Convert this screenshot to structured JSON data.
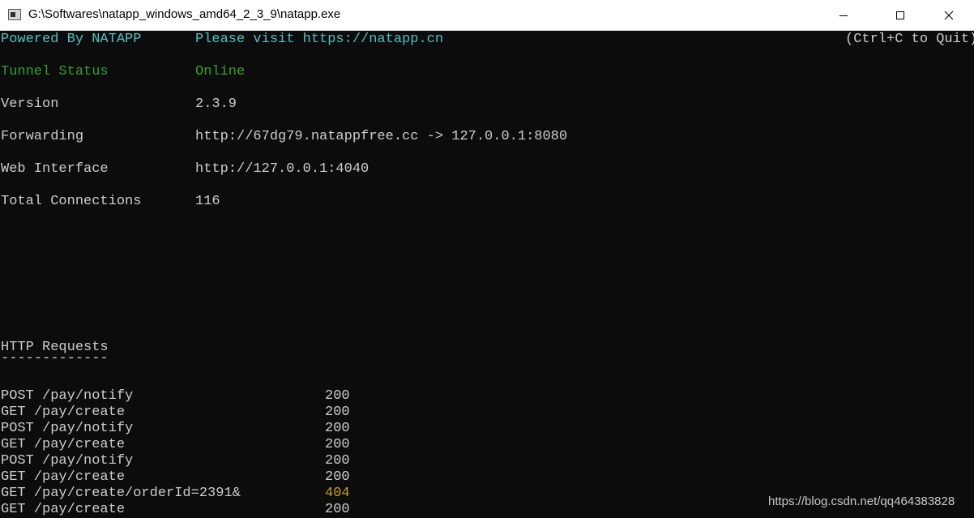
{
  "window": {
    "title": "G:\\Softwares\\natapp_windows_amd64_2_3_9\\natapp.exe"
  },
  "header": {
    "powered_by": "Powered By NATAPP",
    "visit": "Please visit https://natapp.cn",
    "quit_hint": "(Ctrl+C to Quit)"
  },
  "status": {
    "tunnel_label": "Tunnel Status",
    "tunnel_value": "Online",
    "version_label": "Version",
    "version_value": "2.3.9",
    "forwarding_label": "Forwarding",
    "forwarding_value": "http://67dg79.natappfree.cc -> 127.0.0.1:8080",
    "web_interface_label": "Web Interface",
    "web_interface_value": "http://127.0.0.1:4040",
    "connections_label": "Total Connections",
    "connections_value": "116"
  },
  "requests": {
    "heading": "HTTP Requests",
    "underline": "-------------",
    "rows": [
      {
        "request": "POST /pay/notify",
        "code": "200"
      },
      {
        "request": "GET /pay/create",
        "code": "200"
      },
      {
        "request": "POST /pay/notify",
        "code": "200"
      },
      {
        "request": "GET /pay/create",
        "code": "200"
      },
      {
        "request": "POST /pay/notify",
        "code": "200"
      },
      {
        "request": "GET /pay/create",
        "code": "200"
      },
      {
        "request": "GET /pay/create/orderId=2391&",
        "code": "404"
      },
      {
        "request": "GET /pay/create",
        "code": "200"
      }
    ]
  },
  "watermark": "https://blog.csdn.net/qq464383828",
  "colors": {
    "background": "#0c0c0c",
    "cyan": "#4fc1c1",
    "green": "#2ea12e",
    "text": "#cccccc",
    "error_code": "#c8a21f"
  }
}
